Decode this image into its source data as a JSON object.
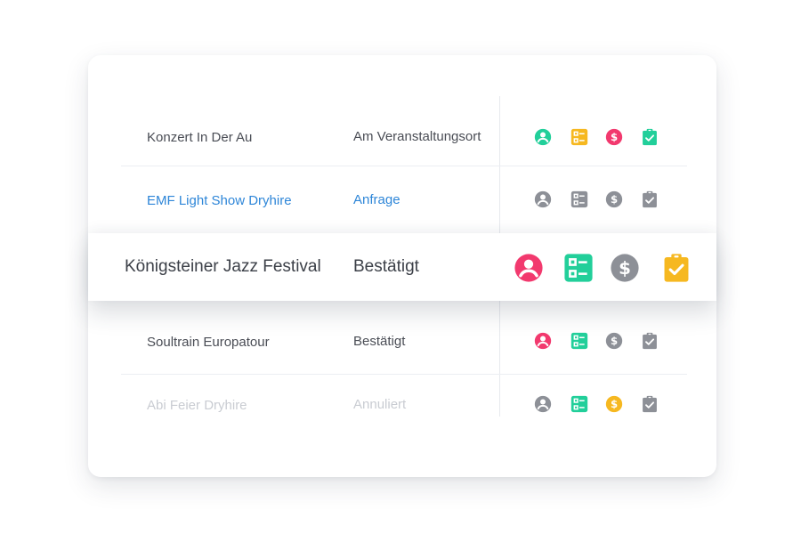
{
  "colors": {
    "green": "#22cf9a",
    "yellow": "#f6b820",
    "pink": "#f2396e",
    "gray": "#8d9097",
    "blue": "#2e86d8",
    "text_dark": "#4a4d55",
    "text_faded": "#c9ccd2"
  },
  "rows": [
    {
      "name": "Konzert In Der Au",
      "status": "Am Veranstaltungsort",
      "icons": [
        {
          "icon": "person-icon",
          "color": "green"
        },
        {
          "icon": "checklist-icon",
          "color": "yellow"
        },
        {
          "icon": "dollar-icon",
          "color": "pink"
        },
        {
          "icon": "clipboard-check-icon",
          "color": "green"
        }
      ]
    },
    {
      "name": "EMF Light Show Dryhire",
      "status": "Anfrage",
      "icons": [
        {
          "icon": "person-icon",
          "color": "gray"
        },
        {
          "icon": "checklist-icon",
          "color": "gray"
        },
        {
          "icon": "dollar-icon",
          "color": "gray"
        },
        {
          "icon": "clipboard-check-icon",
          "color": "gray"
        }
      ]
    },
    {
      "name": "Königsteiner Jazz Festival",
      "status": "Bestätigt",
      "icons": [
        {
          "icon": "person-icon",
          "color": "pink"
        },
        {
          "icon": "checklist-icon",
          "color": "green"
        },
        {
          "icon": "dollar-icon",
          "color": "gray"
        },
        {
          "icon": "clipboard-check-icon",
          "color": "yellow"
        }
      ]
    },
    {
      "name": "Soultrain Europatour",
      "status": "Bestätigt",
      "icons": [
        {
          "icon": "person-icon",
          "color": "pink"
        },
        {
          "icon": "checklist-icon",
          "color": "green"
        },
        {
          "icon": "dollar-icon",
          "color": "gray"
        },
        {
          "icon": "clipboard-check-icon",
          "color": "gray"
        }
      ]
    },
    {
      "name": "Abi Feier Dryhire",
      "status": "Annuliert",
      "icons": [
        {
          "icon": "person-icon",
          "color": "gray"
        },
        {
          "icon": "checklist-icon",
          "color": "green"
        },
        {
          "icon": "dollar-icon",
          "color": "yellow"
        },
        {
          "icon": "clipboard-check-icon",
          "color": "gray"
        }
      ]
    }
  ]
}
